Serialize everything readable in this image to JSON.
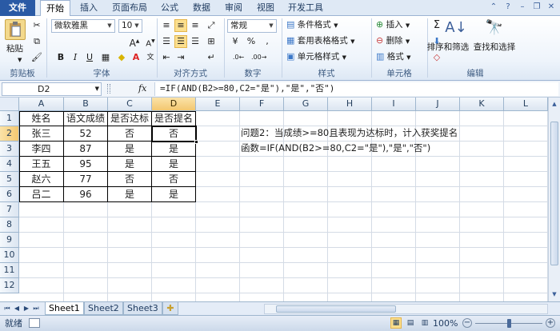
{
  "tabs": {
    "file": "文件",
    "home": "开始",
    "insert": "插入",
    "page_layout": "页面布局",
    "formulas": "公式",
    "data": "数据",
    "review": "审阅",
    "view": "视图",
    "developer": "开发工具"
  },
  "ribbon": {
    "clipboard": {
      "paste": "粘贴",
      "label": "剪贴板"
    },
    "font": {
      "name": "微软雅黑",
      "size": "10",
      "bold": "B",
      "italic": "I",
      "underline": "U",
      "label": "字体"
    },
    "alignment": {
      "label": "对齐方式"
    },
    "number": {
      "format": "常规",
      "percent": "%",
      "label": "数字"
    },
    "styles": {
      "conditional": "条件格式",
      "table": "套用表格格式",
      "cell": "单元格样式",
      "label": "样式"
    },
    "cells": {
      "insert": "插入",
      "delete": "删除",
      "format": "格式",
      "label": "单元格"
    },
    "editing": {
      "sum": "Σ",
      "sort": "排序和筛选",
      "find": "查找和选择",
      "label": "编辑"
    }
  },
  "formula_bar": {
    "name_box": "D2",
    "fx": "fx",
    "formula": "=IF(AND(B2>=80,C2=\"是\"),\"是\",\"否\")"
  },
  "grid": {
    "columns": [
      "A",
      "B",
      "C",
      "D",
      "E",
      "F",
      "G",
      "H",
      "I",
      "J",
      "K",
      "L"
    ],
    "rows": [
      "1",
      "2",
      "3",
      "4",
      "5",
      "6",
      "7",
      "8",
      "9",
      "10",
      "11",
      "12"
    ],
    "header": [
      "姓名",
      "语文成绩",
      "是否达标",
      "是否提名"
    ],
    "data": [
      [
        "张三",
        "52",
        "否",
        "否"
      ],
      [
        "李四",
        "87",
        "是",
        "是"
      ],
      [
        "王五",
        "95",
        "是",
        "是"
      ],
      [
        "赵六",
        "77",
        "否",
        "否"
      ],
      [
        "吕二",
        "96",
        "是",
        "是"
      ]
    ],
    "note_line1": "问题2：当成绩>=80且表现为达标时，计入获奖提名",
    "note_line2": "函数=IF(AND(B2>=80,C2=\"是\"),\"是\",\"否\")"
  },
  "sheets": [
    "Sheet1",
    "Sheet2",
    "Sheet3"
  ],
  "status": {
    "ready": "就绪",
    "zoom": "100%"
  }
}
